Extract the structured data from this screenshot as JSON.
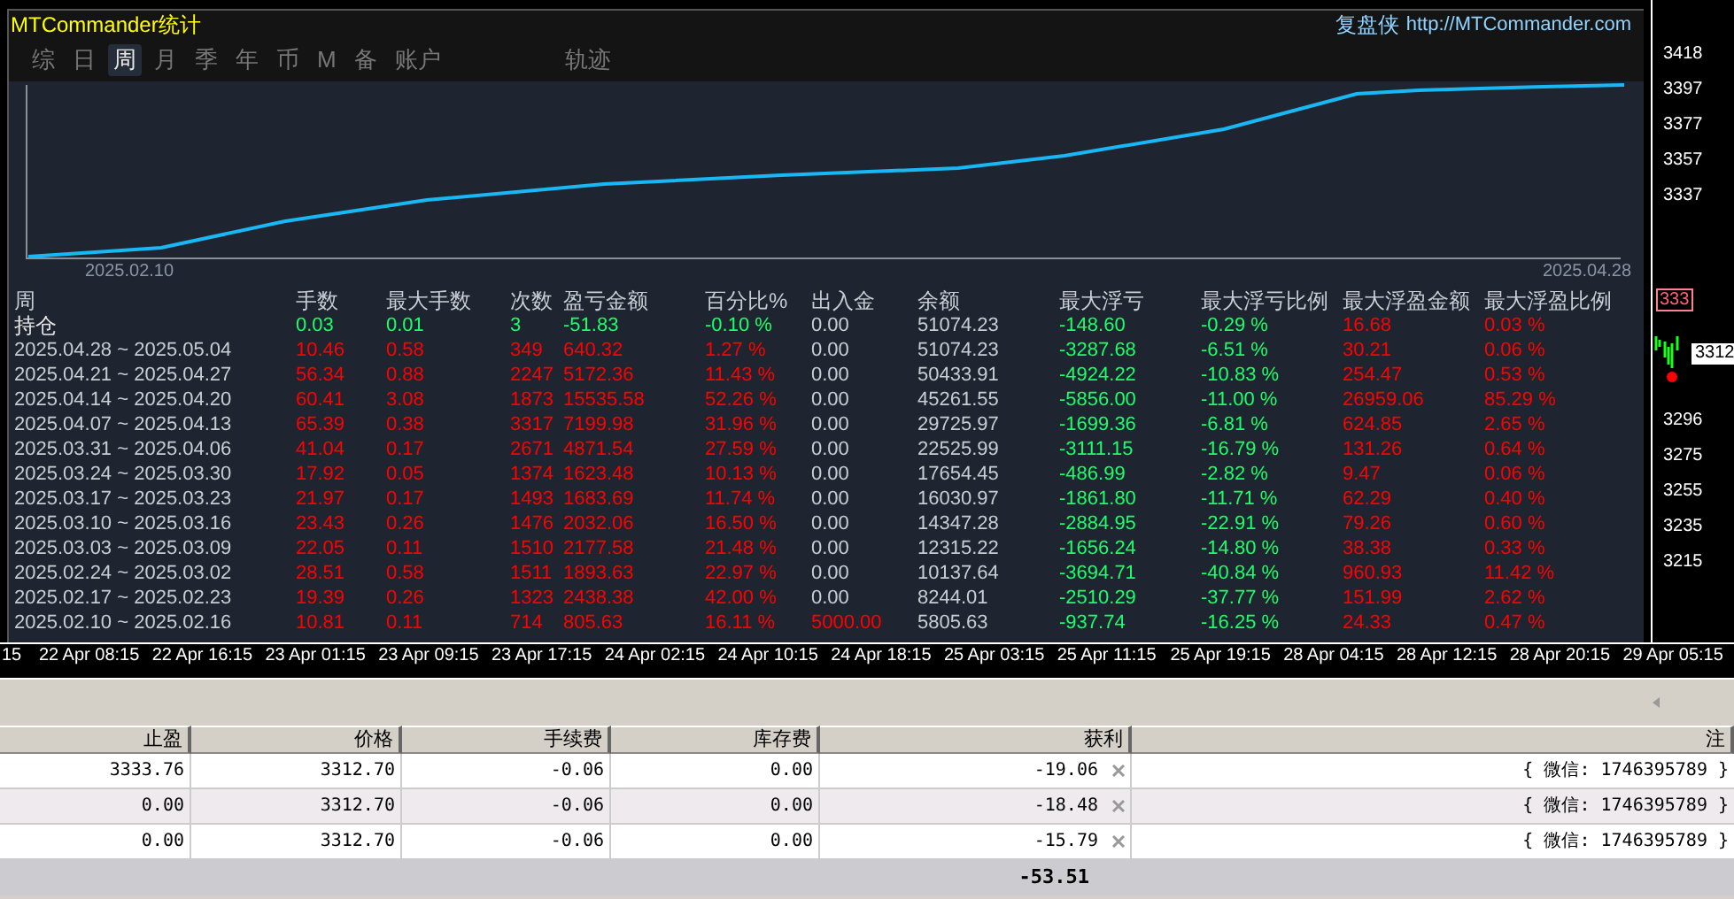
{
  "panel": {
    "title": "MTCommander统计",
    "brand": "复盘侠",
    "link": "http://MTCommander.com",
    "tabs": [
      {
        "label": "综",
        "selected": false
      },
      {
        "label": "日",
        "selected": false
      },
      {
        "label": "周",
        "selected": true
      },
      {
        "label": "月",
        "selected": false
      },
      {
        "label": "季",
        "selected": false
      },
      {
        "label": "年",
        "selected": false
      },
      {
        "label": "币",
        "selected": false
      },
      {
        "label": "M",
        "selected": false
      },
      {
        "label": "备",
        "selected": false
      },
      {
        "label": "账户",
        "selected": false
      }
    ],
    "track_tab": {
      "label": "轨迹",
      "selected": false
    },
    "equity_chart": {
      "start_label": "2025.02.10",
      "end_label": "2025.04.28"
    },
    "stats_table": {
      "columns": [
        "周",
        "手数",
        "最大手数",
        "次数",
        "盈亏金额",
        "百分比%",
        "出入金",
        "余额",
        "最大浮亏",
        "最大浮亏比例",
        "最大浮盈金额",
        "最大浮盈比例"
      ],
      "rows": [
        {
          "cells": [
            {
              "text": "持仓",
              "color": "#e6e6e6"
            },
            {
              "text": "0.03",
              "color": "#19ff6a"
            },
            {
              "text": "0.01",
              "color": "#19ff6a"
            },
            {
              "text": "3",
              "color": "#19ff6a"
            },
            {
              "text": "-51.83",
              "color": "#19ff6a"
            },
            {
              "text": "-0.10 %",
              "color": "#19ff6a"
            },
            {
              "text": "0.00",
              "color": "#c8ccd4"
            },
            {
              "text": "51074.23",
              "color": "#c8ccd4"
            },
            {
              "text": "-148.60",
              "color": "#19ff6a"
            },
            {
              "text": "-0.29 %",
              "color": "#19ff6a"
            },
            {
              "text": "16.68",
              "color": "#ff0000"
            },
            {
              "text": "0.03 %",
              "color": "#ff0000"
            }
          ]
        },
        {
          "cells": [
            {
              "text": "2025.04.28 ~ 2025.05.04",
              "color": "#c8ccd4"
            },
            {
              "text": "10.46",
              "color": "#ff0000"
            },
            {
              "text": "0.58",
              "color": "#ff0000"
            },
            {
              "text": "349",
              "color": "#ff0000"
            },
            {
              "text": "640.32",
              "color": "#ff0000"
            },
            {
              "text": "1.27 %",
              "color": "#ff0000"
            },
            {
              "text": "0.00",
              "color": "#c8ccd4"
            },
            {
              "text": "51074.23",
              "color": "#c8ccd4"
            },
            {
              "text": "-3287.68",
              "color": "#19ff6a"
            },
            {
              "text": "-6.51 %",
              "color": "#19ff6a"
            },
            {
              "text": "30.21",
              "color": "#ff0000"
            },
            {
              "text": "0.06 %",
              "color": "#ff0000"
            }
          ]
        },
        {
          "cells": [
            {
              "text": "2025.04.21 ~ 2025.04.27",
              "color": "#c8ccd4"
            },
            {
              "text": "56.34",
              "color": "#ff0000"
            },
            {
              "text": "0.88",
              "color": "#ff0000"
            },
            {
              "text": "2247",
              "color": "#ff0000"
            },
            {
              "text": "5172.36",
              "color": "#ff0000"
            },
            {
              "text": "11.43 %",
              "color": "#ff0000"
            },
            {
              "text": "0.00",
              "color": "#c8ccd4"
            },
            {
              "text": "50433.91",
              "color": "#c8ccd4"
            },
            {
              "text": "-4924.22",
              "color": "#19ff6a"
            },
            {
              "text": "-10.83 %",
              "color": "#19ff6a"
            },
            {
              "text": "254.47",
              "color": "#ff0000"
            },
            {
              "text": "0.53 %",
              "color": "#ff0000"
            }
          ]
        },
        {
          "cells": [
            {
              "text": "2025.04.14 ~ 2025.04.20",
              "color": "#c8ccd4"
            },
            {
              "text": "60.41",
              "color": "#ff0000"
            },
            {
              "text": "3.08",
              "color": "#ff0000"
            },
            {
              "text": "1873",
              "color": "#ff0000"
            },
            {
              "text": "15535.58",
              "color": "#ff0000"
            },
            {
              "text": "52.26 %",
              "color": "#ff0000"
            },
            {
              "text": "0.00",
              "color": "#c8ccd4"
            },
            {
              "text": "45261.55",
              "color": "#c8ccd4"
            },
            {
              "text": "-5856.00",
              "color": "#19ff6a"
            },
            {
              "text": "-11.00 %",
              "color": "#19ff6a"
            },
            {
              "text": "26959.06",
              "color": "#ff0000"
            },
            {
              "text": "85.29 %",
              "color": "#ff0000"
            }
          ]
        },
        {
          "cells": [
            {
              "text": "2025.04.07 ~ 2025.04.13",
              "color": "#c8ccd4"
            },
            {
              "text": "65.39",
              "color": "#ff0000"
            },
            {
              "text": "0.38",
              "color": "#ff0000"
            },
            {
              "text": "3317",
              "color": "#ff0000"
            },
            {
              "text": "7199.98",
              "color": "#ff0000"
            },
            {
              "text": "31.96 %",
              "color": "#ff0000"
            },
            {
              "text": "0.00",
              "color": "#c8ccd4"
            },
            {
              "text": "29725.97",
              "color": "#c8ccd4"
            },
            {
              "text": "-1699.36",
              "color": "#19ff6a"
            },
            {
              "text": "-6.81 %",
              "color": "#19ff6a"
            },
            {
              "text": "624.85",
              "color": "#ff0000"
            },
            {
              "text": "2.65 %",
              "color": "#ff0000"
            }
          ]
        },
        {
          "cells": [
            {
              "text": "2025.03.31 ~ 2025.04.06",
              "color": "#c8ccd4"
            },
            {
              "text": "41.04",
              "color": "#ff0000"
            },
            {
              "text": "0.17",
              "color": "#ff0000"
            },
            {
              "text": "2671",
              "color": "#ff0000"
            },
            {
              "text": "4871.54",
              "color": "#ff0000"
            },
            {
              "text": "27.59 %",
              "color": "#ff0000"
            },
            {
              "text": "0.00",
              "color": "#c8ccd4"
            },
            {
              "text": "22525.99",
              "color": "#c8ccd4"
            },
            {
              "text": "-3111.15",
              "color": "#19ff6a"
            },
            {
              "text": "-16.79 %",
              "color": "#19ff6a"
            },
            {
              "text": "131.26",
              "color": "#ff0000"
            },
            {
              "text": "0.64 %",
              "color": "#ff0000"
            }
          ]
        },
        {
          "cells": [
            {
              "text": "2025.03.24 ~ 2025.03.30",
              "color": "#c8ccd4"
            },
            {
              "text": "17.92",
              "color": "#ff0000"
            },
            {
              "text": "0.05",
              "color": "#ff0000"
            },
            {
              "text": "1374",
              "color": "#ff0000"
            },
            {
              "text": "1623.48",
              "color": "#ff0000"
            },
            {
              "text": "10.13 %",
              "color": "#ff0000"
            },
            {
              "text": "0.00",
              "color": "#c8ccd4"
            },
            {
              "text": "17654.45",
              "color": "#c8ccd4"
            },
            {
              "text": "-486.99",
              "color": "#19ff6a"
            },
            {
              "text": "-2.82 %",
              "color": "#19ff6a"
            },
            {
              "text": "9.47",
              "color": "#ff0000"
            },
            {
              "text": "0.06 %",
              "color": "#ff0000"
            }
          ]
        },
        {
          "cells": [
            {
              "text": "2025.03.17 ~ 2025.03.23",
              "color": "#c8ccd4"
            },
            {
              "text": "21.97",
              "color": "#ff0000"
            },
            {
              "text": "0.17",
              "color": "#ff0000"
            },
            {
              "text": "1493",
              "color": "#ff0000"
            },
            {
              "text": "1683.69",
              "color": "#ff0000"
            },
            {
              "text": "11.74 %",
              "color": "#ff0000"
            },
            {
              "text": "0.00",
              "color": "#c8ccd4"
            },
            {
              "text": "16030.97",
              "color": "#c8ccd4"
            },
            {
              "text": "-1861.80",
              "color": "#19ff6a"
            },
            {
              "text": "-11.71 %",
              "color": "#19ff6a"
            },
            {
              "text": "62.29",
              "color": "#ff0000"
            },
            {
              "text": "0.40 %",
              "color": "#ff0000"
            }
          ]
        },
        {
          "cells": [
            {
              "text": "2025.03.10 ~ 2025.03.16",
              "color": "#c8ccd4"
            },
            {
              "text": "23.43",
              "color": "#ff0000"
            },
            {
              "text": "0.26",
              "color": "#ff0000"
            },
            {
              "text": "1476",
              "color": "#ff0000"
            },
            {
              "text": "2032.06",
              "color": "#ff0000"
            },
            {
              "text": "16.50 %",
              "color": "#ff0000"
            },
            {
              "text": "0.00",
              "color": "#c8ccd4"
            },
            {
              "text": "14347.28",
              "color": "#c8ccd4"
            },
            {
              "text": "-2884.95",
              "color": "#19ff6a"
            },
            {
              "text": "-22.91 %",
              "color": "#19ff6a"
            },
            {
              "text": "79.26",
              "color": "#ff0000"
            },
            {
              "text": "0.60 %",
              "color": "#ff0000"
            }
          ]
        },
        {
          "cells": [
            {
              "text": "2025.03.03 ~ 2025.03.09",
              "color": "#c8ccd4"
            },
            {
              "text": "22.05",
              "color": "#ff0000"
            },
            {
              "text": "0.11",
              "color": "#ff0000"
            },
            {
              "text": "1510",
              "color": "#ff0000"
            },
            {
              "text": "2177.58",
              "color": "#ff0000"
            },
            {
              "text": "21.48 %",
              "color": "#ff0000"
            },
            {
              "text": "0.00",
              "color": "#c8ccd4"
            },
            {
              "text": "12315.22",
              "color": "#c8ccd4"
            },
            {
              "text": "-1656.24",
              "color": "#19ff6a"
            },
            {
              "text": "-14.80 %",
              "color": "#19ff6a"
            },
            {
              "text": "38.38",
              "color": "#ff0000"
            },
            {
              "text": "0.33 %",
              "color": "#ff0000"
            }
          ]
        },
        {
          "cells": [
            {
              "text": "2025.02.24 ~ 2025.03.02",
              "color": "#c8ccd4"
            },
            {
              "text": "28.51",
              "color": "#ff0000"
            },
            {
              "text": "0.58",
              "color": "#ff0000"
            },
            {
              "text": "1511",
              "color": "#ff0000"
            },
            {
              "text": "1893.63",
              "color": "#ff0000"
            },
            {
              "text": "22.97 %",
              "color": "#ff0000"
            },
            {
              "text": "0.00",
              "color": "#c8ccd4"
            },
            {
              "text": "10137.64",
              "color": "#c8ccd4"
            },
            {
              "text": "-3694.71",
              "color": "#19ff6a"
            },
            {
              "text": "-40.84 %",
              "color": "#19ff6a"
            },
            {
              "text": "960.93",
              "color": "#ff0000"
            },
            {
              "text": "11.42 %",
              "color": "#ff0000"
            }
          ]
        },
        {
          "cells": [
            {
              "text": "2025.02.17 ~ 2025.02.23",
              "color": "#c8ccd4"
            },
            {
              "text": "19.39",
              "color": "#ff0000"
            },
            {
              "text": "0.26",
              "color": "#ff0000"
            },
            {
              "text": "1323",
              "color": "#ff0000"
            },
            {
              "text": "2438.38",
              "color": "#ff0000"
            },
            {
              "text": "42.00 %",
              "color": "#ff0000"
            },
            {
              "text": "0.00",
              "color": "#c8ccd4"
            },
            {
              "text": "8244.01",
              "color": "#c8ccd4"
            },
            {
              "text": "-2510.29",
              "color": "#19ff6a"
            },
            {
              "text": "-37.77 %",
              "color": "#19ff6a"
            },
            {
              "text": "151.99",
              "color": "#ff0000"
            },
            {
              "text": "2.62 %",
              "color": "#ff0000"
            }
          ]
        },
        {
          "cells": [
            {
              "text": "2025.02.10 ~ 2025.02.16",
              "color": "#c8ccd4"
            },
            {
              "text": "10.81",
              "color": "#ff0000"
            },
            {
              "text": "0.11",
              "color": "#ff0000"
            },
            {
              "text": "714",
              "color": "#ff0000"
            },
            {
              "text": "805.63",
              "color": "#ff0000"
            },
            {
              "text": "16.11 %",
              "color": "#ff0000"
            },
            {
              "text": "5000.00",
              "color": "#ff0000"
            },
            {
              "text": "5805.63",
              "color": "#c8ccd4"
            },
            {
              "text": "-937.74",
              "color": "#19ff6a"
            },
            {
              "text": "-16.25 %",
              "color": "#19ff6a"
            },
            {
              "text": "24.33",
              "color": "#ff0000"
            },
            {
              "text": "0.47 %",
              "color": "#ff0000"
            }
          ]
        }
      ]
    }
  },
  "price_axis": {
    "labels": [
      "3418",
      "3397",
      "3377",
      "3357",
      "3337",
      "3296",
      "3275",
      "3255",
      "3235",
      "3215"
    ],
    "ask_tag": "333",
    "bid_tag": "3312"
  },
  "time_axis": [
    "15",
    "22 Apr 08:15",
    "22 Apr 16:15",
    "23 Apr 01:15",
    "23 Apr 09:15",
    "23 Apr 17:15",
    "24 Apr 02:15",
    "24 Apr 10:15",
    "24 Apr 18:15",
    "25 Apr 03:15",
    "25 Apr 11:15",
    "25 Apr 19:15",
    "28 Apr 04:15",
    "28 Apr 12:15",
    "28 Apr 20:15",
    "29 Apr 05:15"
  ],
  "orders_table": {
    "columns": [
      "止盈",
      "价格",
      "手续费",
      "库存费",
      "获利",
      "注"
    ],
    "rows": [
      {
        "cells": [
          "3333.76",
          "3312.70",
          "-0.06",
          "0.00",
          "-19.06",
          "{ 微信: 1746395789 }"
        ]
      },
      {
        "cells": [
          "0.00",
          "3312.70",
          "-0.06",
          "0.00",
          "-18.48",
          "{ 微信: 1746395789 }"
        ]
      },
      {
        "cells": [
          "0.00",
          "3312.70",
          "-0.06",
          "0.00",
          "-15.79",
          "{ 微信: 1746395789 }"
        ]
      }
    ],
    "total": "-53.51"
  }
}
